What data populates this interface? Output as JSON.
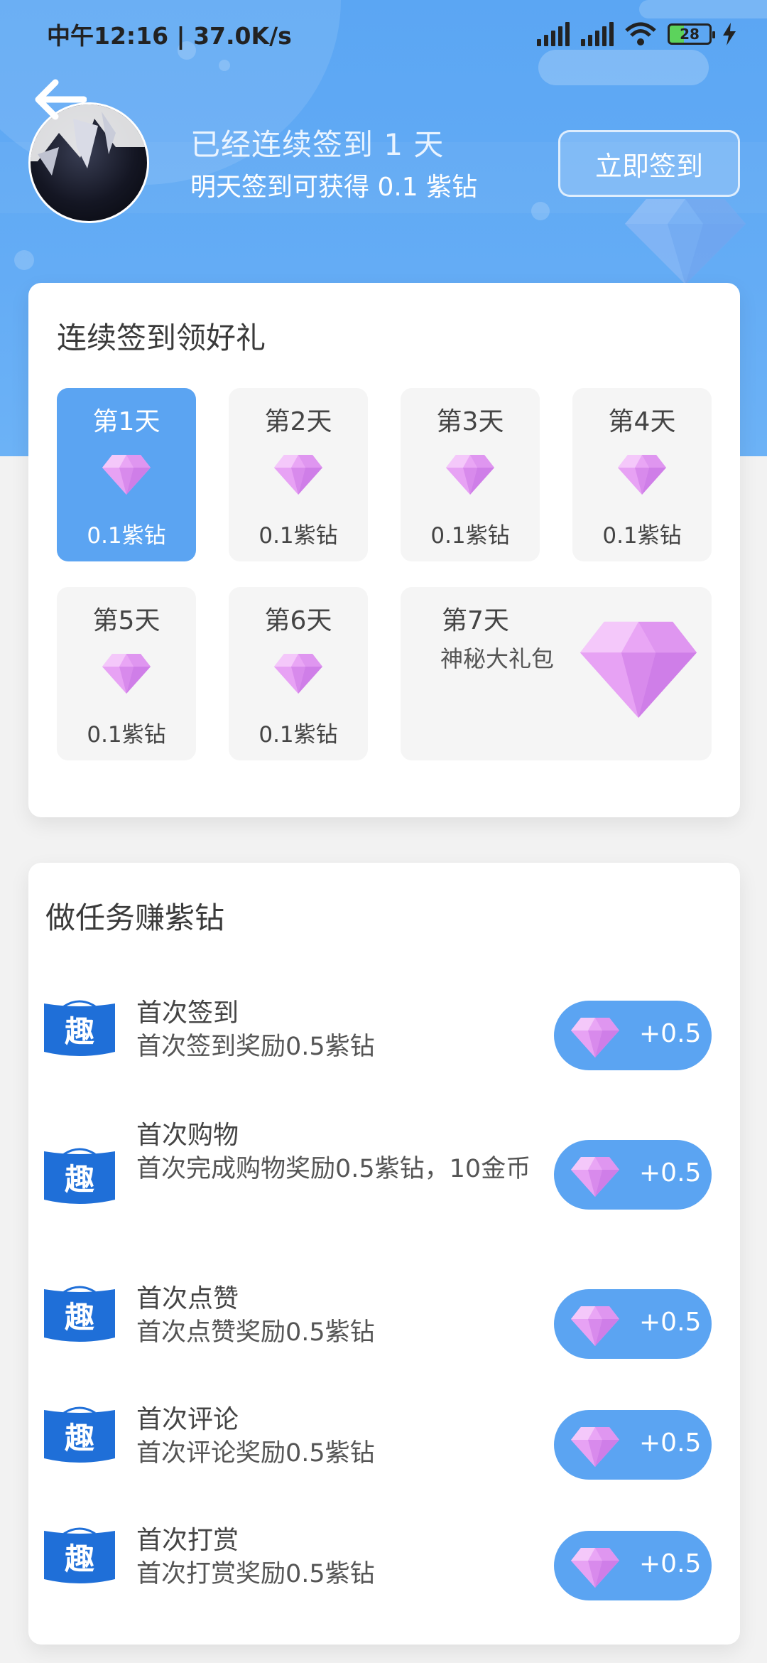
{
  "status_bar": {
    "time_speed": "中午12:16 | 37.0K/s",
    "battery": "28"
  },
  "header": {
    "back_icon": "arrow-left-icon",
    "signed_days_text": "已经连续签到 1 天",
    "tomorrow_reward_text": "明天签到可获得 0.1 紫钻",
    "sign_button": "立即签到"
  },
  "checkin": {
    "title": "连续签到领好礼",
    "days": [
      {
        "label": "第1天",
        "reward": "0.1紫钻",
        "active": true
      },
      {
        "label": "第2天",
        "reward": "0.1紫钻",
        "active": false
      },
      {
        "label": "第3天",
        "reward": "0.1紫钻",
        "active": false
      },
      {
        "label": "第4天",
        "reward": "0.1紫钻",
        "active": false
      },
      {
        "label": "第5天",
        "reward": "0.1紫钻",
        "active": false
      },
      {
        "label": "第6天",
        "reward": "0.1紫钻",
        "active": false
      }
    ],
    "day7": {
      "label": "第7天",
      "reward": "神秘大礼包"
    }
  },
  "tasks": {
    "title": "做任务赚紫钻",
    "items": [
      {
        "icon_text": "趣",
        "name": "首次签到",
        "desc": "首次签到奖励0.5紫钻",
        "reward": "+0.5"
      },
      {
        "icon_text": "趣",
        "name": "首次购物",
        "desc": "首次完成购物奖励0.5紫钻，10金币",
        "reward": "+0.5"
      },
      {
        "icon_text": "趣",
        "name": "首次点赞",
        "desc": "首次点赞奖励0.5紫钻",
        "reward": "+0.5"
      },
      {
        "icon_text": "趣",
        "name": "首次评论",
        "desc": "首次评论奖励0.5紫钻",
        "reward": "+0.5"
      },
      {
        "icon_text": "趣",
        "name": "首次打赏",
        "desc": "首次打赏奖励0.5紫钻",
        "reward": "+0.5"
      }
    ]
  },
  "colors": {
    "primary_blue": "#5ba4f2",
    "gem_purple": "#d98ef0"
  }
}
